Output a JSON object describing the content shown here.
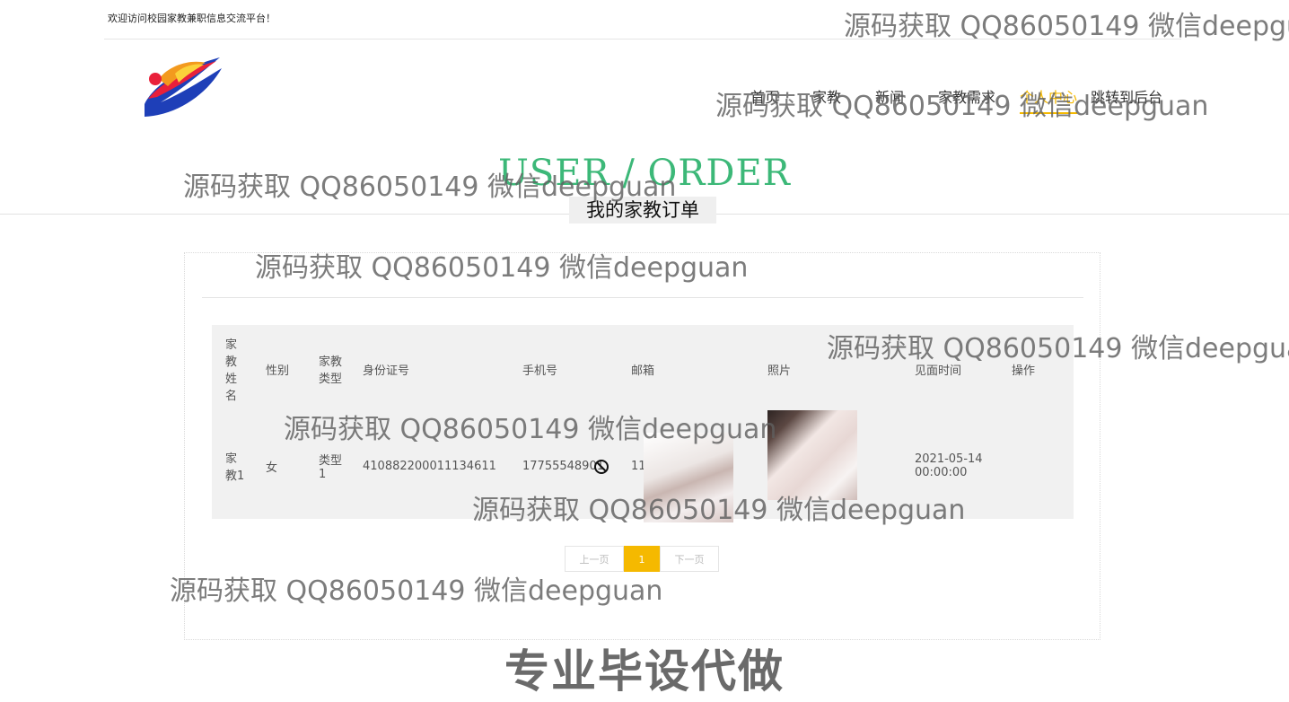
{
  "header": {
    "welcome_text": "欢迎访问校园家教兼职信息交流平台！",
    "nav": [
      {
        "label": "首页",
        "active": false
      },
      {
        "label": "家教",
        "active": false
      },
      {
        "label": "新闻",
        "active": false
      },
      {
        "label": "家教需求",
        "active": false
      },
      {
        "label": "个人中心",
        "active": true
      },
      {
        "label": "跳转到后台",
        "active": false
      }
    ]
  },
  "section": {
    "title_en": "USER / ORDER",
    "title_cn": "我的家教订单"
  },
  "table": {
    "headers": [
      "家教姓名",
      "性别",
      "家教类型",
      "身份证号",
      "手机号",
      "邮箱",
      "照片",
      "见面时间",
      "操作"
    ],
    "rows": [
      {
        "name": "家教1",
        "gender": "女",
        "type": "类型1",
        "id_number": "410882200011134611",
        "phone": "17755548901",
        "email": "111111@qq.com",
        "meet_date": "2021-05-14",
        "meet_time": "00:00:00",
        "action": ""
      }
    ]
  },
  "pagination": {
    "prev_label": "上一页",
    "current_page": "1",
    "next_label": "下一页"
  },
  "overlays": {
    "watermark_text": "源码获取 QQ86050149 微信deepguan",
    "banner_text": "专业毕设代做"
  },
  "colors": {
    "accent": "#f5b900",
    "title_green": "#3cb878",
    "table_bg": "#f1f1f1"
  }
}
